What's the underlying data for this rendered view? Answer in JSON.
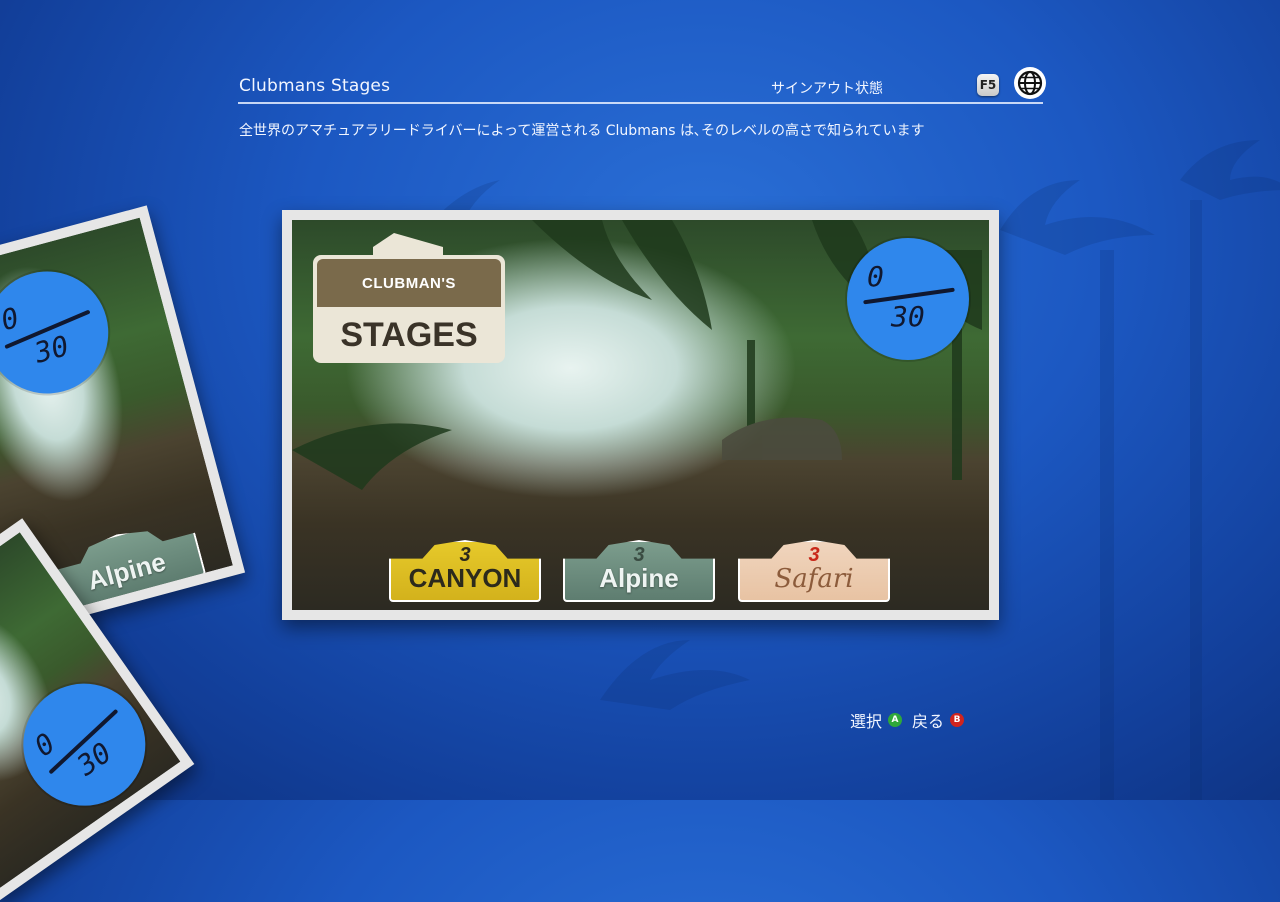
{
  "header": {
    "title": "Clubmans Stages",
    "signin_status": "サインアウト状態",
    "f5_key": "F5",
    "description": "全世界のアマチュアラリードライバーによって運営される Clubmans は､そのレベルの高さで知られています"
  },
  "main_card": {
    "logo_top": "CLUBMAN'S",
    "logo_bottom": "STAGES",
    "progress_done": "0",
    "progress_total": "30",
    "badges": [
      {
        "number": "3",
        "label": "CANYON"
      },
      {
        "number": "3",
        "label": "Alpine"
      },
      {
        "number": "3",
        "label": "Safari"
      }
    ]
  },
  "side_cards": [
    {
      "progress_done": "0",
      "progress_total": "30",
      "badge_label": "Alpine"
    },
    {
      "progress_done": "0",
      "progress_total": "30"
    }
  ],
  "footer": {
    "select_label": "選択",
    "select_button": "A",
    "back_label": "戻る",
    "back_button": "B"
  },
  "colors": {
    "background": "#1c58c2",
    "progress_circle": "#2f87ec",
    "canyon_badge": "#e6c92a",
    "alpine_badge": "#7c9d8d",
    "safari_badge": "#f0d5be",
    "button_a": "#2fa83a",
    "button_b": "#d0241e"
  },
  "icons": [
    "globe-icon",
    "f5-key-icon",
    "palm-silhouette"
  ]
}
